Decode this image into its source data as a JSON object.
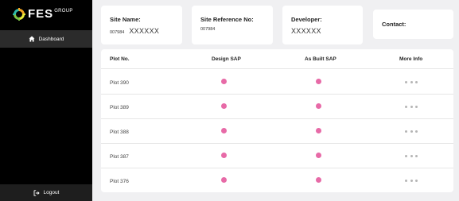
{
  "brand": {
    "name": "FES",
    "suffix": "GROUP"
  },
  "sidebar": {
    "items": [
      {
        "label": "Dashboard",
        "icon": "home-icon"
      }
    ],
    "logout": {
      "label": "Logout",
      "icon": "logout-icon"
    }
  },
  "header": {
    "site_name": {
      "label": "Site Name:",
      "code": "007984",
      "name": "XXXXXX"
    },
    "site_reference": {
      "label": "Site Reference No:",
      "value": "007984"
    },
    "developer": {
      "label": "Developer:",
      "value": "XXXXXX"
    },
    "contact": {
      "label": "Contact:"
    }
  },
  "table": {
    "columns": [
      "Plot No.",
      "Design SAP",
      "As Built SAP",
      "More Info"
    ],
    "rows": [
      {
        "plot": "Plot 390",
        "design_sap": true,
        "as_built_sap": true
      },
      {
        "plot": "Plot 389",
        "design_sap": true,
        "as_built_sap": true
      },
      {
        "plot": "Plot 388",
        "design_sap": true,
        "as_built_sap": true
      },
      {
        "plot": "Plot 387",
        "design_sap": true,
        "as_built_sap": true
      },
      {
        "plot": "Plot 376",
        "design_sap": true,
        "as_built_sap": true
      }
    ]
  },
  "colors": {
    "sidebar_bg": "#000000",
    "active_nav_bg": "#2b2b2b",
    "status_dot": "#e76aa7",
    "more_dots": "#b5b5b5",
    "logo_mark": [
      "#f5a623",
      "#e8eb3a",
      "#7cc243",
      "#2eb8a8"
    ]
  }
}
